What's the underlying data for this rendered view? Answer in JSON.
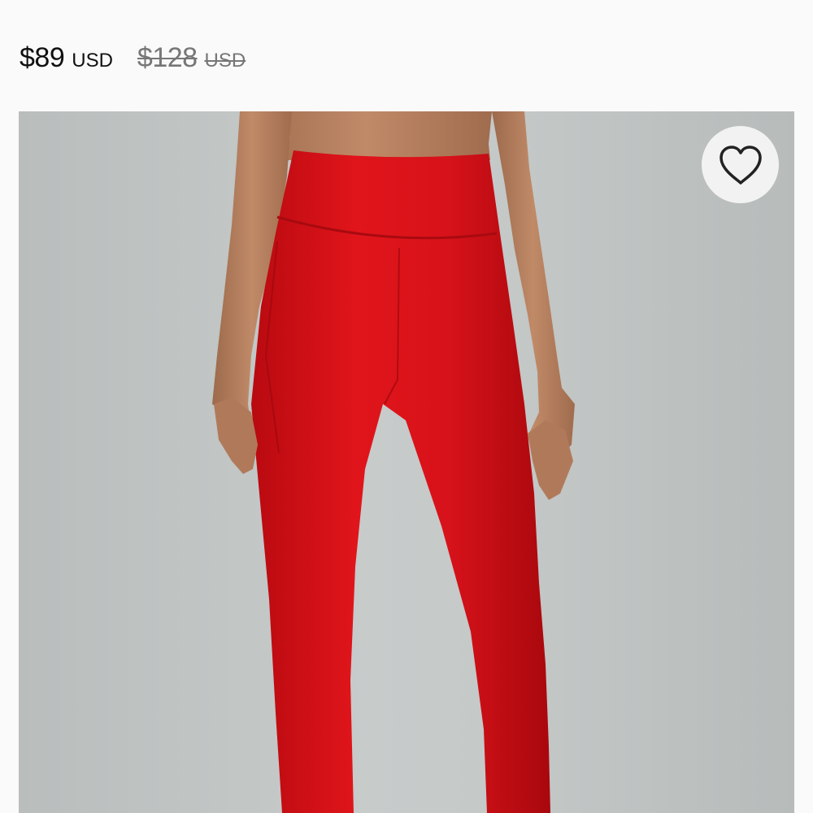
{
  "product": {
    "sale_price": "$89",
    "sale_currency": "USD",
    "original_price": "$128",
    "original_currency": "USD"
  },
  "gallery": {
    "image_subject": "model wearing red high-rise leggings",
    "favorite_icon": "heart-outline-icon"
  },
  "colors": {
    "background": "#fafafa",
    "image_backdrop": "#c3c7c6",
    "product_red": "#d90c12",
    "favorite_button_bg": "#f2f2f2"
  }
}
